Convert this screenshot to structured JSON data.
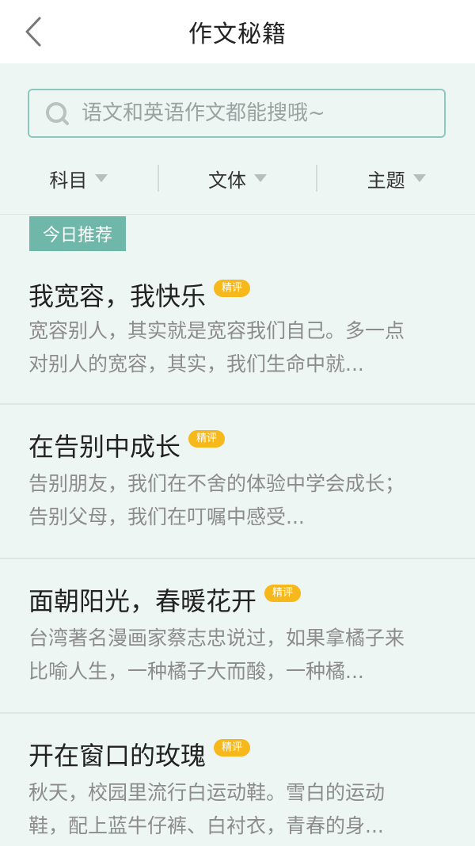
{
  "header": {
    "title": "作文秘籍"
  },
  "search": {
    "placeholder": "语文和英语作文都能搜哦~"
  },
  "filters": [
    {
      "label": "科目"
    },
    {
      "label": "文体"
    },
    {
      "label": "主题"
    }
  ],
  "list": {
    "tag": "今日推荐",
    "badge": "精评",
    "items": [
      {
        "title": "我宽容，我快乐",
        "summary": "宽容别人，其实就是宽容我们自己。多一点\n对别人的宽容，其实，我们生命中就..."
      },
      {
        "title": "在告别中成长",
        "summary": "告别朋友，我们在不舍的体验中学会成长；\n告别父母，我们在叮嘱中感受..."
      },
      {
        "title": "面朝阳光，春暖花开",
        "summary": "台湾著名漫画家蔡志忠说过，如果拿橘子来\n比喻人生，一种橘子大而酸，一种橘..."
      },
      {
        "title": "开在窗口的玫瑰",
        "summary": "秋天，校园里流行白运动鞋。雪白的运动\n鞋，配上蓝牛仔裤、白衬衣，青春的身..."
      }
    ]
  },
  "colors": {
    "accent": "#6fb7a8",
    "badge": "#f6b81a",
    "background": "#eef6f4"
  }
}
